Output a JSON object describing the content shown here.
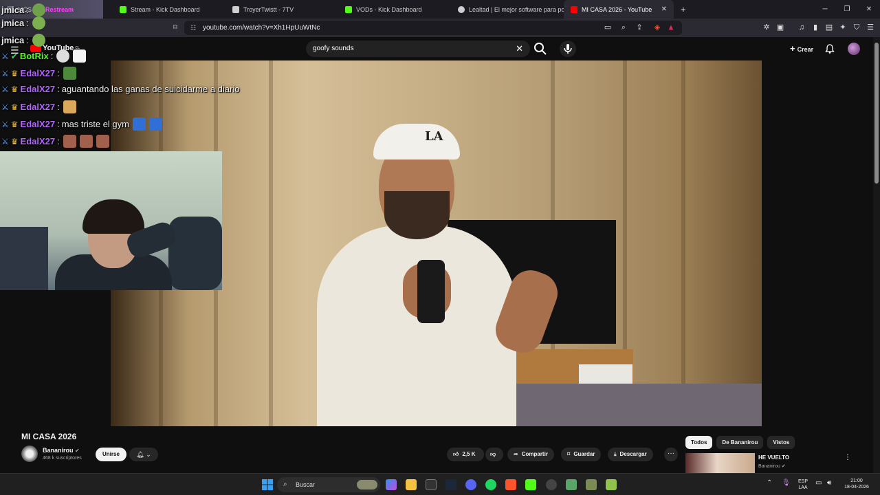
{
  "browser": {
    "tabs": [
      {
        "label": "MCS",
        "color": "#6f7788"
      },
      {
        "label": "Stream - Kick Dashboard",
        "color": "#53fc18"
      },
      {
        "label": "TroyerTwistt - 7TV",
        "color": "#cfcfcf"
      },
      {
        "label": "VODs - Kick Dashboard",
        "color": "#53fc18"
      },
      {
        "label": "Lealtad | El mejor software para pote",
        "color": "#cfcfcf"
      },
      {
        "label": "MI CASA 2026 - YouTube",
        "color": "#ff0000"
      }
    ],
    "overlay_tag": "Restream",
    "new_tab": "+",
    "url": "youtube.com/watch?v=Xh1HpUuWtNc"
  },
  "youtube": {
    "logo": "YouTube",
    "logo_region": "CL",
    "search_query": "goofy sounds",
    "create_label": "Crear"
  },
  "chat": [
    {
      "user": "jmica",
      "text": "",
      "color": "#e8e8e8",
      "emotes": 1
    },
    {
      "user": "jmica",
      "text": "",
      "color": "#e8e8e8",
      "emotes": 1
    },
    {
      "user": "BotRix",
      "text": "",
      "color": "#53fc18",
      "emotes": 2
    },
    {
      "user": "EdalX27",
      "text": "",
      "color": "#b266ff",
      "emotes": 1
    },
    {
      "user": "EdalX27",
      "text": "aguantando las ganas de suicidarme a diario",
      "color": "#b266ff",
      "emotes": 0
    },
    {
      "user": "EdalX27",
      "text": "",
      "color": "#b266ff",
      "emotes": 1
    },
    {
      "user": "EdalX27",
      "text": "mas triste el gym",
      "color": "#b266ff",
      "emotes": 2
    },
    {
      "user": "EdalX27",
      "text": "",
      "color": "#b266ff",
      "emotes": 3
    }
  ],
  "video": {
    "title": "MI CASA 2026",
    "cap_logo": "LA",
    "channel": "Bananirou",
    "subscribers": "468 k suscriptores",
    "join_label": "Unirse",
    "likes": "2,5 K",
    "share_label": "Compartir",
    "save_label": "Guardar",
    "download_label": "Descargar"
  },
  "recommendations": {
    "chips": [
      "Todos",
      "De Bananirou",
      "Vistos"
    ],
    "items": [
      {
        "title": "HE VUELTO",
        "channel": "Bananirou"
      }
    ]
  },
  "taskbar": {
    "search_placeholder": "Buscar",
    "lang_top": "ESP",
    "lang_bottom": "LAA",
    "time": "21:00",
    "date": "18-04-2026"
  }
}
